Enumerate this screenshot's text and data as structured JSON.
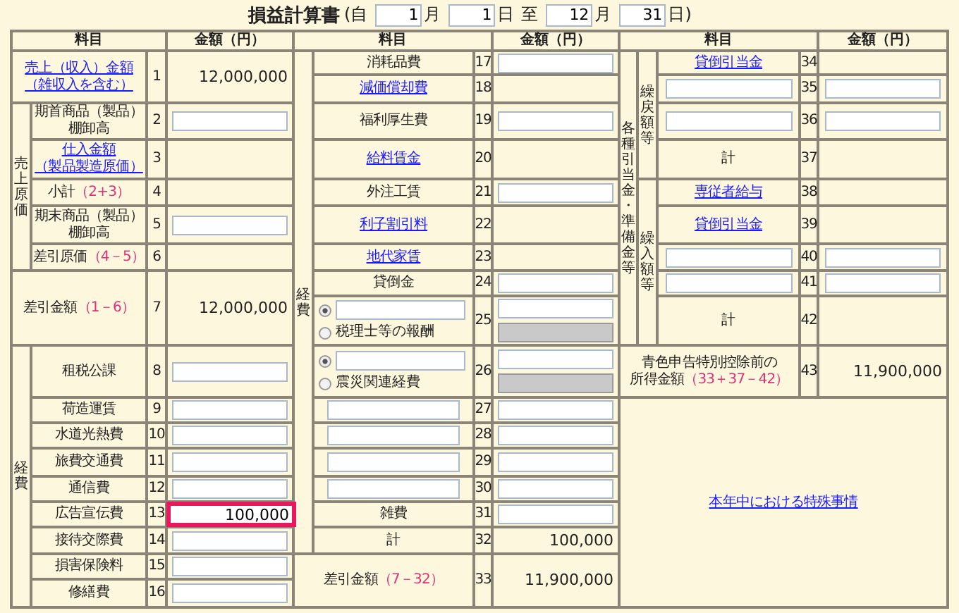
{
  "title": {
    "text": "損益計算書",
    "parts": [
      {
        "kind": "text",
        "text": "(自"
      },
      {
        "kind": "field",
        "value": "1"
      },
      {
        "kind": "text",
        "text": "月"
      },
      {
        "kind": "field",
        "value": "1"
      },
      {
        "kind": "text",
        "text": "日"
      },
      {
        "kind": "text",
        "text": "至"
      },
      {
        "kind": "field",
        "value": "12"
      },
      {
        "kind": "text",
        "text": "月"
      },
      {
        "kind": "field",
        "value": "31"
      },
      {
        "kind": "text",
        "text": "日)"
      }
    ]
  },
  "sections": [
    {
      "header": {
        "subject": "料目",
        "amount": "金額（円）"
      },
      "items": [
        {
          "kind": "row",
          "no": "1",
          "label": {
            "kind": "link",
            "lines": [
              "売上（収入）金額",
              "（雑収入を含む）"
            ]
          },
          "amount": {
            "kind": "text",
            "value": "12,000,000"
          }
        },
        {
          "kind": "group",
          "label": "売上原価",
          "children": [
            {
              "kind": "row",
              "no": "2",
              "label": {
                "kind": "text",
                "lines": [
                  "期首商品（製品）",
                  "棚卸高"
                ]
              },
              "amount": {
                "kind": "field",
                "highlighted": false
              }
            },
            {
              "kind": "row",
              "no": "3",
              "label": {
                "kind": "link",
                "lines": [
                  "仕入金額",
                  "（製品製造原価）"
                ]
              }
            },
            {
              "kind": "row",
              "no": "4",
              "label": {
                "kind": "text",
                "lines": [
                  "小計"
                ],
                "formula": "（2+3）"
              }
            },
            {
              "kind": "row",
              "no": "5",
              "label": {
                "kind": "text",
                "lines": [
                  "期末商品（製品）",
                  "棚卸高"
                ]
              },
              "amount": {
                "kind": "field",
                "highlighted": false
              }
            },
            {
              "kind": "row",
              "no": "6",
              "label": {
                "kind": "text",
                "lines": [
                  "差引原価"
                ],
                "formula": "（4－5）"
              }
            }
          ]
        },
        {
          "kind": "row",
          "no": "7",
          "label": {
            "kind": "text",
            "lines": [
              "差引金額"
            ],
            "formula": "（1－6）"
          },
          "amount": {
            "kind": "text",
            "value": "12,000,000"
          }
        },
        {
          "kind": "group",
          "label": "経費",
          "children": [
            {
              "kind": "row",
              "no": "8",
              "label": {
                "kind": "text",
                "lines": [
                  "租税公課"
                ]
              },
              "amount": {
                "kind": "field",
                "highlighted": false
              }
            },
            {
              "kind": "row",
              "no": "9",
              "label": {
                "kind": "text",
                "lines": [
                  "荷造運賃"
                ]
              },
              "amount": {
                "kind": "field",
                "highlighted": false
              }
            },
            {
              "kind": "row",
              "no": "10",
              "label": {
                "kind": "text",
                "lines": [
                  "水道光熱費"
                ]
              },
              "amount": {
                "kind": "field",
                "highlighted": false
              }
            },
            {
              "kind": "row",
              "no": "11",
              "label": {
                "kind": "text",
                "lines": [
                  "旅費交通費"
                ]
              },
              "amount": {
                "kind": "field",
                "highlighted": false
              }
            },
            {
              "kind": "row",
              "no": "12",
              "label": {
                "kind": "text",
                "lines": [
                  "通信費"
                ]
              },
              "amount": {
                "kind": "field",
                "highlighted": false
              }
            },
            {
              "kind": "row",
              "no": "13",
              "label": {
                "kind": "text",
                "lines": [
                  "広告宣伝費"
                ]
              },
              "amount": {
                "kind": "field",
                "value": "100,000",
                "highlighted": true
              }
            },
            {
              "kind": "row",
              "no": "14",
              "label": {
                "kind": "text",
                "lines": [
                  "接待交際費"
                ]
              },
              "amount": {
                "kind": "field",
                "highlighted": false
              }
            },
            {
              "kind": "row",
              "no": "15",
              "label": {
                "kind": "text",
                "lines": [
                  "損害保険料"
                ]
              },
              "amount": {
                "kind": "field",
                "highlighted": false
              }
            },
            {
              "kind": "row",
              "no": "16",
              "label": {
                "kind": "text",
                "lines": [
                  "修繕費"
                ]
              },
              "amount": {
                "kind": "field",
                "highlighted": false
              }
            }
          ]
        }
      ]
    },
    {
      "header": {
        "subject": "料目",
        "amount": "金額（円）"
      },
      "items": [
        {
          "kind": "group",
          "label": "経費",
          "children": [
            {
              "kind": "row",
              "no": "17",
              "label": {
                "kind": "text",
                "lines": [
                  "消耗品費"
                ]
              },
              "amount": {
                "kind": "field",
                "highlighted": false
              }
            },
            {
              "kind": "row",
              "no": "18",
              "label": {
                "kind": "link",
                "lines": [
                  "減価償却費"
                ]
              }
            },
            {
              "kind": "row",
              "no": "19",
              "label": {
                "kind": "text",
                "lines": [
                  "福利厚生費"
                ]
              },
              "amount": {
                "kind": "field",
                "highlighted": false
              }
            },
            {
              "kind": "row",
              "no": "20",
              "label": {
                "kind": "link",
                "lines": [
                  "給料賃金"
                ]
              }
            },
            {
              "kind": "row",
              "no": "21",
              "label": {
                "kind": "text",
                "lines": [
                  "外注工賃"
                ]
              },
              "amount": {
                "kind": "field",
                "highlighted": false
              }
            },
            {
              "kind": "row",
              "no": "22",
              "label": {
                "kind": "link",
                "lines": [
                  "利子割引料"
                ]
              }
            },
            {
              "kind": "row",
              "no": "23",
              "label": {
                "kind": "link",
                "lines": [
                  "地代家賃"
                ]
              }
            },
            {
              "kind": "row",
              "no": "24",
              "label": {
                "kind": "text",
                "lines": [
                  "貸倒金"
                ]
              },
              "amount": {
                "kind": "field",
                "highlighted": false
              }
            },
            {
              "kind": "row",
              "no": "25",
              "label": {
                "kind": "radio_pair",
                "options": [
                  {
                    "kind": "field",
                    "selected": true
                  },
                  {
                    "kind": "text",
                    "text": "税理士等の報酬",
                    "selected": false
                  }
                ]
              },
              "amount": {
                "kind": "field_pair",
                "fields": [
                  {
                    "disabled": false,
                    "highlighted": false
                  },
                  {
                    "disabled": true,
                    "highlighted": false
                  }
                ]
              }
            },
            {
              "kind": "row",
              "no": "26",
              "label": {
                "kind": "radio_pair",
                "options": [
                  {
                    "kind": "field",
                    "selected": true
                  },
                  {
                    "kind": "text",
                    "text": "震災関連経費",
                    "selected": false
                  }
                ]
              },
              "amount": {
                "kind": "field_pair",
                "fields": [
                  {
                    "disabled": false,
                    "highlighted": false
                  },
                  {
                    "disabled": true,
                    "highlighted": false
                  }
                ]
              }
            },
            {
              "kind": "row",
              "no": "27",
              "label": {
                "kind": "field"
              },
              "amount": {
                "kind": "field",
                "highlighted": false
              }
            },
            {
              "kind": "row",
              "no": "28",
              "label": {
                "kind": "field"
              },
              "amount": {
                "kind": "field",
                "highlighted": false
              }
            },
            {
              "kind": "row",
              "no": "29",
              "label": {
                "kind": "field"
              },
              "amount": {
                "kind": "field",
                "highlighted": false
              }
            },
            {
              "kind": "row",
              "no": "30",
              "label": {
                "kind": "field"
              },
              "amount": {
                "kind": "field",
                "highlighted": false
              }
            },
            {
              "kind": "row",
              "no": "31",
              "label": {
                "kind": "text",
                "lines": [
                  "雑費"
                ]
              },
              "amount": {
                "kind": "field",
                "highlighted": false
              }
            },
            {
              "kind": "row",
              "no": "32",
              "label": {
                "kind": "text",
                "lines": [
                  "計"
                ]
              },
              "amount": {
                "kind": "text",
                "value": "100,000"
              }
            }
          ]
        },
        {
          "kind": "row",
          "no": "33",
          "label": {
            "kind": "text",
            "lines": [
              "差引金額"
            ],
            "formula": "（7－32）"
          },
          "amount": {
            "kind": "text",
            "value": "11,900,000"
          }
        }
      ]
    },
    {
      "header": {
        "subject": "料目",
        "amount": "金額（円）"
      },
      "items": [
        {
          "kind": "group",
          "label": "各種引当金・準備金等",
          "children": [
            {
              "kind": "group",
              "label": "繰戻額等",
              "children": [
                {
                  "kind": "row",
                  "no": "34",
                  "label": {
                    "kind": "link",
                    "lines": [
                      "貸倒引当金"
                    ]
                  }
                },
                {
                  "kind": "row",
                  "no": "35",
                  "label": {
                    "kind": "field"
                  },
                  "amount": {
                    "kind": "field",
                    "highlighted": false
                  }
                },
                {
                  "kind": "row",
                  "no": "36",
                  "label": {
                    "kind": "field"
                  },
                  "amount": {
                    "kind": "field",
                    "highlighted": false
                  }
                },
                {
                  "kind": "row",
                  "no": "37",
                  "label": {
                    "kind": "text",
                    "lines": [
                      "計"
                    ]
                  }
                }
              ]
            },
            {
              "kind": "group",
              "label": "繰入額等",
              "children": [
                {
                  "kind": "row",
                  "no": "38",
                  "label": {
                    "kind": "link",
                    "lines": [
                      "専従者給与"
                    ]
                  }
                },
                {
                  "kind": "row",
                  "no": "39",
                  "label": {
                    "kind": "link",
                    "lines": [
                      "貸倒引当金"
                    ]
                  }
                },
                {
                  "kind": "row",
                  "no": "40",
                  "label": {
                    "kind": "field"
                  },
                  "amount": {
                    "kind": "field",
                    "highlighted": false
                  }
                },
                {
                  "kind": "row",
                  "no": "41",
                  "label": {
                    "kind": "field"
                  },
                  "amount": {
                    "kind": "field",
                    "highlighted": false
                  }
                },
                {
                  "kind": "row",
                  "no": "42",
                  "label": {
                    "kind": "text",
                    "lines": [
                      "計"
                    ]
                  }
                }
              ]
            }
          ]
        },
        {
          "kind": "row",
          "no": "43",
          "label": {
            "kind": "text",
            "lines": [
              "青色申告特別控除前の",
              "所得金額"
            ],
            "formula": "（33＋37－42）"
          },
          "amount": {
            "kind": "text",
            "value": "11,900,000"
          }
        },
        {
          "kind": "note",
          "link": "本年中における特殊事情"
        }
      ]
    }
  ]
}
